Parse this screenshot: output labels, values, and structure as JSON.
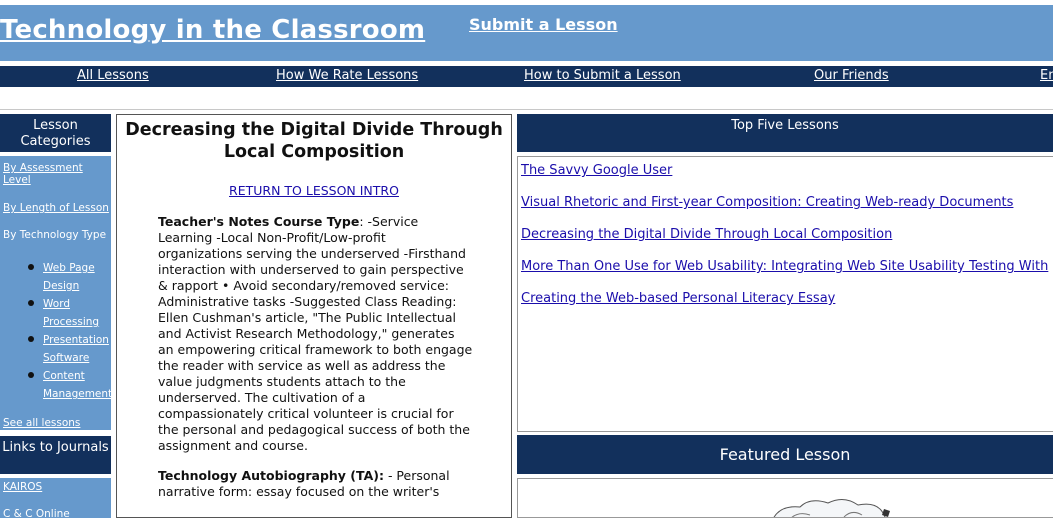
{
  "header": {
    "site_title": "Technology in the Classroom",
    "submit_link": "Submit a Lesson"
  },
  "nav": {
    "items": [
      "All Lessons",
      "How We Rate Lessons",
      "How to Submit a Lesson",
      "Our Friends",
      "En"
    ]
  },
  "sidebar": {
    "categories_heading": "Lesson Categories",
    "by_assessment": "By Assessment Level",
    "by_length": "By Length of Lesson",
    "by_technology": "By Technology Type",
    "tech_types": [
      "Web Page Design",
      "Word Processing",
      "Presentation Software",
      "Content Management"
    ],
    "see_all": "See all lessons",
    "journals_heading": "Links to Journals",
    "journals": [
      "KAIROS",
      "C & C Online"
    ]
  },
  "lesson": {
    "title": "Decreasing the Digital Divide Through Local Composition",
    "return_link": "RETURN TO LESSON INTRO",
    "notes_heading": "Teacher's Notes Course Type",
    "notes_body": ": -Service Learning -Local Non-Profit/Low-profit organizations serving the underserved -Firsthand interaction with underserved to gain perspective & rapport • Avoid secondary/removed service: Administrative tasks -Suggested Class Reading: Ellen Cushman's article, \"The Public Intellectual and Activist Research Methodology,\" generates an empowering critical framework to both engage the reader with service as well as address the value judgments students attach to the underserved. The cultivation of a compassionately critical volunteer is crucial for the personal and pedagogical success of both the assignment and course.",
    "ta_heading": "Technology Autobiography (TA):",
    "ta_body": " - Personal narrative form: essay focused on the writer's"
  },
  "top_five": {
    "heading": "Top Five Lessons",
    "items": [
      "The Savvy Google User",
      "Visual Rhetoric and First-year Composition: Creating Web-ready Documents",
      "Decreasing the Digital Divide Through Local Composition",
      "More Than One Use for Web Usability: Integrating Web Site Usability Testing With",
      "Creating the Web-based Personal Literacy Essay"
    ]
  },
  "featured": {
    "heading": "Featured Lesson"
  }
}
